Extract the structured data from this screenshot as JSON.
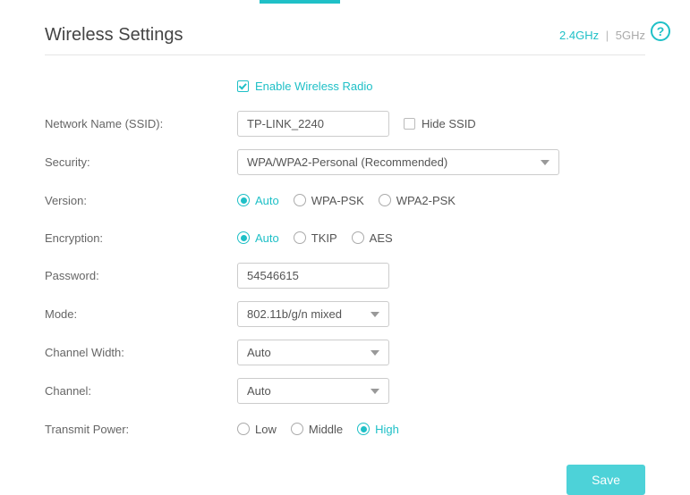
{
  "header": {
    "title": "Wireless Settings",
    "band_24": "2.4GHz",
    "band_5": "5GHz",
    "sep": "|"
  },
  "enable": {
    "label": "Enable Wireless Radio",
    "checked": true
  },
  "ssid": {
    "label": "Network Name (SSID):",
    "value": "TP-LINK_2240",
    "hide_label": "Hide SSID",
    "hide_checked": false
  },
  "security": {
    "label": "Security:",
    "value": "WPA/WPA2-Personal (Recommended)"
  },
  "version": {
    "label": "Version:",
    "options": [
      "Auto",
      "WPA-PSK",
      "WPA2-PSK"
    ],
    "selected": "Auto"
  },
  "encryption": {
    "label": "Encryption:",
    "options": [
      "Auto",
      "TKIP",
      "AES"
    ],
    "selected": "Auto"
  },
  "password": {
    "label": "Password:",
    "value": "54546615"
  },
  "mode": {
    "label": "Mode:",
    "value": "802.11b/g/n mixed"
  },
  "channel_width": {
    "label": "Channel Width:",
    "value": "Auto"
  },
  "channel": {
    "label": "Channel:",
    "value": "Auto"
  },
  "transmit": {
    "label": "Transmit Power:",
    "options": [
      "Low",
      "Middle",
      "High"
    ],
    "selected": "High"
  },
  "save_label": "Save"
}
